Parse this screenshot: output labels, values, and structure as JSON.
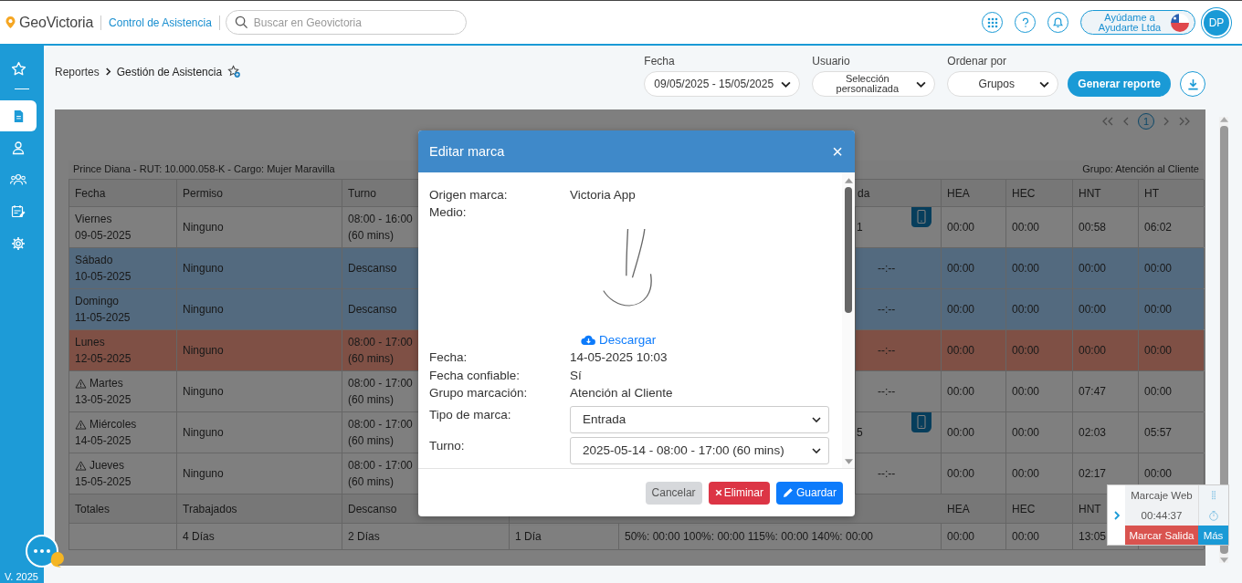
{
  "topbar": {
    "brand": "GeoVictoria",
    "module": "Control de Asistencia",
    "search": {
      "placeholder": "Buscar en Geovictoria"
    },
    "account": "Ayúdame a Ayudarte Ltda",
    "avatar": "DP"
  },
  "sidebar": {
    "items": [
      {
        "kind": "favorites",
        "selected": false
      },
      {
        "kind": "reports",
        "selected": true
      },
      {
        "kind": "person",
        "selected": false
      },
      {
        "kind": "group",
        "selected": false
      },
      {
        "kind": "schedule",
        "selected": false
      },
      {
        "kind": "settings",
        "selected": false
      }
    ],
    "version": "V. 2025"
  },
  "breadcrumb": [
    "Reportes",
    "Gestión de Asistencia"
  ],
  "filters": [
    {
      "label": "Fecha",
      "value": "09/05/2025 - 15/05/2025"
    },
    {
      "label": "Usuario",
      "value": "Selección personalizada"
    },
    {
      "label": "Ordenar por",
      "value": "Grupos"
    }
  ],
  "generate_button": "Generar reporte",
  "pagination": {
    "pages": [
      {
        "label": "1",
        "selected": true
      }
    ]
  },
  "report": {
    "employee": "Prince Diana - RUT: 10.000.058-K - Cargo: Mujer Maravilla",
    "group": "Grupo: Atención al Cliente",
    "columns": [
      "Fecha",
      "Permiso",
      "Turno",
      "da",
      "HEA",
      "HEC",
      "HNT",
      "HT"
    ],
    "rows": [
      {
        "kind": "workday",
        "warning": false,
        "day": "Viernes",
        "date": "09-05-2025",
        "permiso": "Ninguno",
        "shift": "08:00 - 16:00",
        "break": "(60 mins)",
        "column_5": "1",
        "device": true,
        "hea": "00:00",
        "hec": "00:00",
        "hnt": "00:58",
        "ht": "06:02"
      },
      {
        "kind": "rest",
        "warning": false,
        "day": "Sábado",
        "date": "10-05-2025",
        "permiso": "Ninguno",
        "shift": "Descanso",
        "column_5": "--:--",
        "device": false,
        "hea": "00:00",
        "hec": "00:00",
        "hnt": "00:00",
        "ht": "00:00"
      },
      {
        "kind": "rest",
        "warning": false,
        "day": "Domingo",
        "date": "11-05-2025",
        "permiso": "Ninguno",
        "shift": "Descanso",
        "column_5": "--:--",
        "device": false,
        "hea": "00:00",
        "hec": "00:00",
        "hnt": "00:00",
        "ht": "00:00"
      },
      {
        "kind": "absent",
        "warning": false,
        "day": "Lunes",
        "date": "12-05-2025",
        "permiso": "Ninguno",
        "shift": "08:00 - 17:00",
        "break": "(60 mins)",
        "column_5": "--:--",
        "device": false,
        "hea": "00:00",
        "hec": "00:00",
        "hnt": "00:00",
        "ht": "00:00"
      },
      {
        "kind": "workday",
        "warning": true,
        "day": "Martes",
        "date": "13-05-2025",
        "permiso": "Ninguno",
        "shift": "08:00 - 17:00",
        "break": "(60 mins)",
        "column_5": "--:--",
        "device": false,
        "hea": "00:00",
        "hec": "00:00",
        "hnt": "07:47",
        "ht": "00:00"
      },
      {
        "kind": "workday",
        "warning": true,
        "day": "Miércoles",
        "date": "14-05-2025",
        "permiso": "Ninguno",
        "shift": "08:00 - 17:00",
        "break": "(60 mins)",
        "column_5": "5",
        "device": true,
        "hea": "00:00",
        "hec": "00:00",
        "hnt": "02:03",
        "ht": "05:57"
      },
      {
        "kind": "workday",
        "warning": true,
        "day": "Jueves",
        "date": "15-05-2025",
        "permiso": "Ninguno",
        "shift": "08:00 - 17:00",
        "break": "(60 mins)",
        "column_5": "--:--",
        "device": false,
        "hea": "00:00",
        "hec": "00:00",
        "hnt": "02:17",
        "ht": "00:00"
      }
    ],
    "totals_columns": [
      "Totales",
      "Trabajados",
      "Descanso",
      "HEA",
      "HEC",
      "HNT"
    ],
    "totals": {
      "trabajados": "4 Días",
      "descanso": "2 Días",
      "column_4": "1 Día",
      "column_5": "50%: 00:00 100%: 00:00 115%: 00:00 140%: 00:00",
      "hea": "00:00",
      "hec": "00:00",
      "hnt": "13:05"
    }
  },
  "modal": {
    "title": "Editar marca",
    "close": "×",
    "fields": [
      {
        "label": "Origen marca:",
        "value": "Victoria App"
      },
      {
        "label": "Medio:"
      }
    ],
    "download": "Descargar",
    "details": [
      {
        "label": "Fecha:",
        "value": "14-05-2025 10:03"
      },
      {
        "label": "Fecha confiable:",
        "value": "Sí"
      },
      {
        "label": "Grupo marcación:",
        "value": "Atención al Cliente"
      }
    ],
    "selects": [
      {
        "label": "Tipo de marca:",
        "value": "Entrada"
      },
      {
        "label": "Turno:",
        "value": "2025-05-14 - 08:00 - 17:00 (60 mins)"
      }
    ],
    "buttons": [
      {
        "kind": "cancel",
        "label": "Cancelar"
      },
      {
        "kind": "delete",
        "label": "Eliminar"
      },
      {
        "kind": "save",
        "label": "Guardar"
      }
    ]
  },
  "widget": {
    "title": "Marcaje Web",
    "time": "00:44:37",
    "action": "Marcar Salida",
    "more": "Más"
  }
}
